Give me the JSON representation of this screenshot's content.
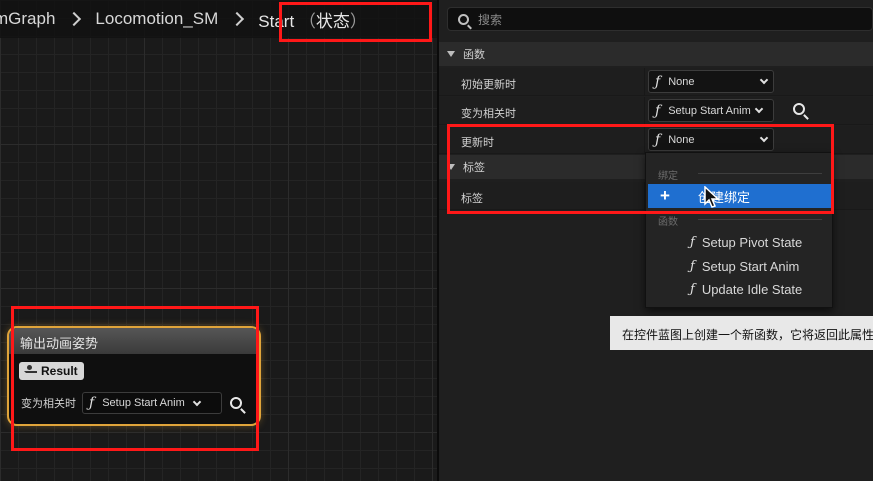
{
  "breadcrumb": {
    "items": [
      "mGraph",
      "Locomotion_SM"
    ],
    "current": "Start",
    "current_suffix": "状态"
  },
  "node": {
    "title": "输出动画姿势",
    "result_pin": "Result",
    "relevant_label": "变为相关时",
    "relevant_value": "Setup Start Anim"
  },
  "details": {
    "search_placeholder": "搜索",
    "sections": {
      "functions": "函数",
      "tags": "标签"
    },
    "rows": [
      {
        "label": "初始更新时",
        "value": "None"
      },
      {
        "label": "变为相关时",
        "value": "Setup Start Anim"
      },
      {
        "label": "更新时",
        "value": "None"
      },
      {
        "label": "标签",
        "value": ""
      }
    ]
  },
  "menu": {
    "bind_section": "绑定",
    "create_binding": "创建绑定",
    "functions_section": "函数",
    "items": [
      "Setup Pivot State",
      "Setup Start Anim",
      "Update Idle State"
    ]
  },
  "tooltip": {
    "text": "在控件蓝图上创建一个新函数，它将返回此属性的绑定数据。"
  },
  "colors": {
    "highlight": "#1f6fd0",
    "annotation": "#ff1818",
    "node_border": "#e0a43a"
  }
}
